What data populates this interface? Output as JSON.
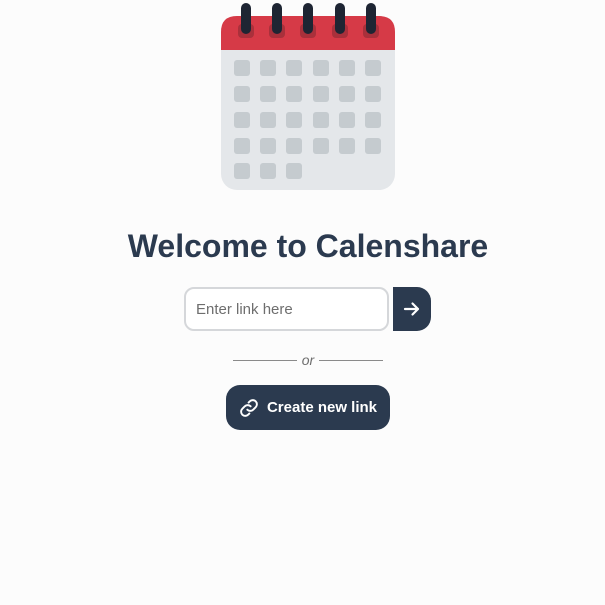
{
  "logo": {
    "icon": "calendar-icon"
  },
  "heading": {
    "title": "Welcome to Calenshare"
  },
  "link_form": {
    "input_value": "",
    "placeholder": "Enter link here",
    "submit_icon": "arrow-right-icon"
  },
  "divider": {
    "text": "or"
  },
  "create_button": {
    "icon": "link-icon",
    "label": "Create new link"
  },
  "colors": {
    "background": "#fcfcfc",
    "primary": "#2b3a4f",
    "calendar_header": "#d63a47",
    "calendar_body": "#e4e7ea",
    "calendar_cells": "#c5cbcf",
    "rings": "#1e2533"
  }
}
